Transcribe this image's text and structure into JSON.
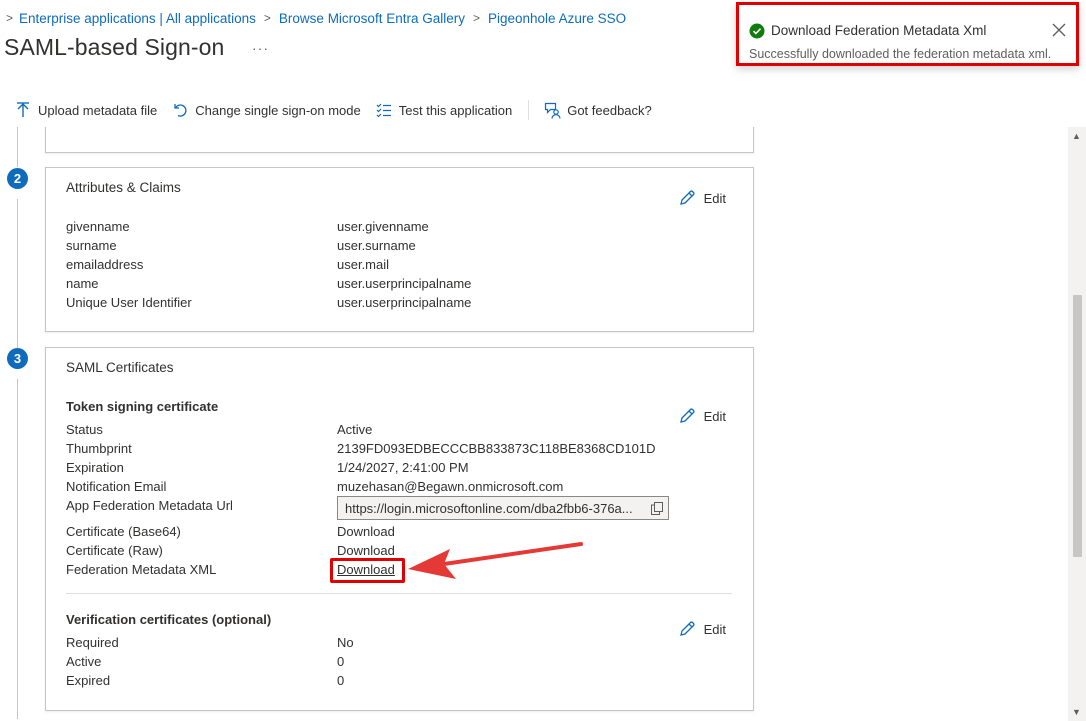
{
  "breadcrumb": {
    "items": [
      "Enterprise applications | All applications",
      "Browse Microsoft Entra Gallery",
      "Pigeonhole Azure SSO"
    ]
  },
  "page": {
    "title": "SAML-based Sign-on",
    "more": "···"
  },
  "toolbar": {
    "upload": "Upload metadata file",
    "change_mode": "Change single sign-on mode",
    "test_app": "Test this application",
    "feedback": "Got feedback?"
  },
  "steps": {
    "attributes": {
      "number": "2",
      "title": "Attributes & Claims",
      "edit": "Edit",
      "rows": [
        {
          "label": "givenname",
          "value": "user.givenname"
        },
        {
          "label": "surname",
          "value": "user.surname"
        },
        {
          "label": "emailaddress",
          "value": "user.mail"
        },
        {
          "label": "name",
          "value": "user.userprincipalname"
        },
        {
          "label": "Unique User Identifier",
          "value": "user.userprincipalname"
        }
      ]
    },
    "certificates": {
      "number": "3",
      "title": "SAML Certificates",
      "token_heading": "Token signing certificate",
      "edit": "Edit",
      "status_label": "Status",
      "status_value": "Active",
      "thumbprint_label": "Thumbprint",
      "thumbprint_value": "2139FD093EDBECCCBB833873C118BE8368CD101D",
      "expiration_label": "Expiration",
      "expiration_value": "1/24/2027, 2:41:00 PM",
      "email_label": "Notification Email",
      "email_value": "muzehasan@Begawn.onmicrosoft.com",
      "metadata_url_label": "App Federation Metadata Url",
      "metadata_url_value": "https://login.microsoftonline.com/dba2fbb6-376a...",
      "base64_label": "Certificate (Base64)",
      "base64_link": "Download",
      "raw_label": "Certificate (Raw)",
      "raw_link": "Download",
      "fedxml_label": "Federation Metadata XML",
      "fedxml_link": "Download",
      "verification_heading": "Verification certificates (optional)",
      "verification_edit": "Edit",
      "required_label": "Required",
      "required_value": "No",
      "active_label": "Active",
      "active_value": "0",
      "expired_label": "Expired",
      "expired_value": "0"
    }
  },
  "toast": {
    "title": "Download Federation Metadata Xml",
    "message": "Successfully downloaded the federation metadata xml."
  },
  "colors": {
    "accent": "#0f6cbd",
    "highlight": "#e00000",
    "success": "#107c10"
  }
}
